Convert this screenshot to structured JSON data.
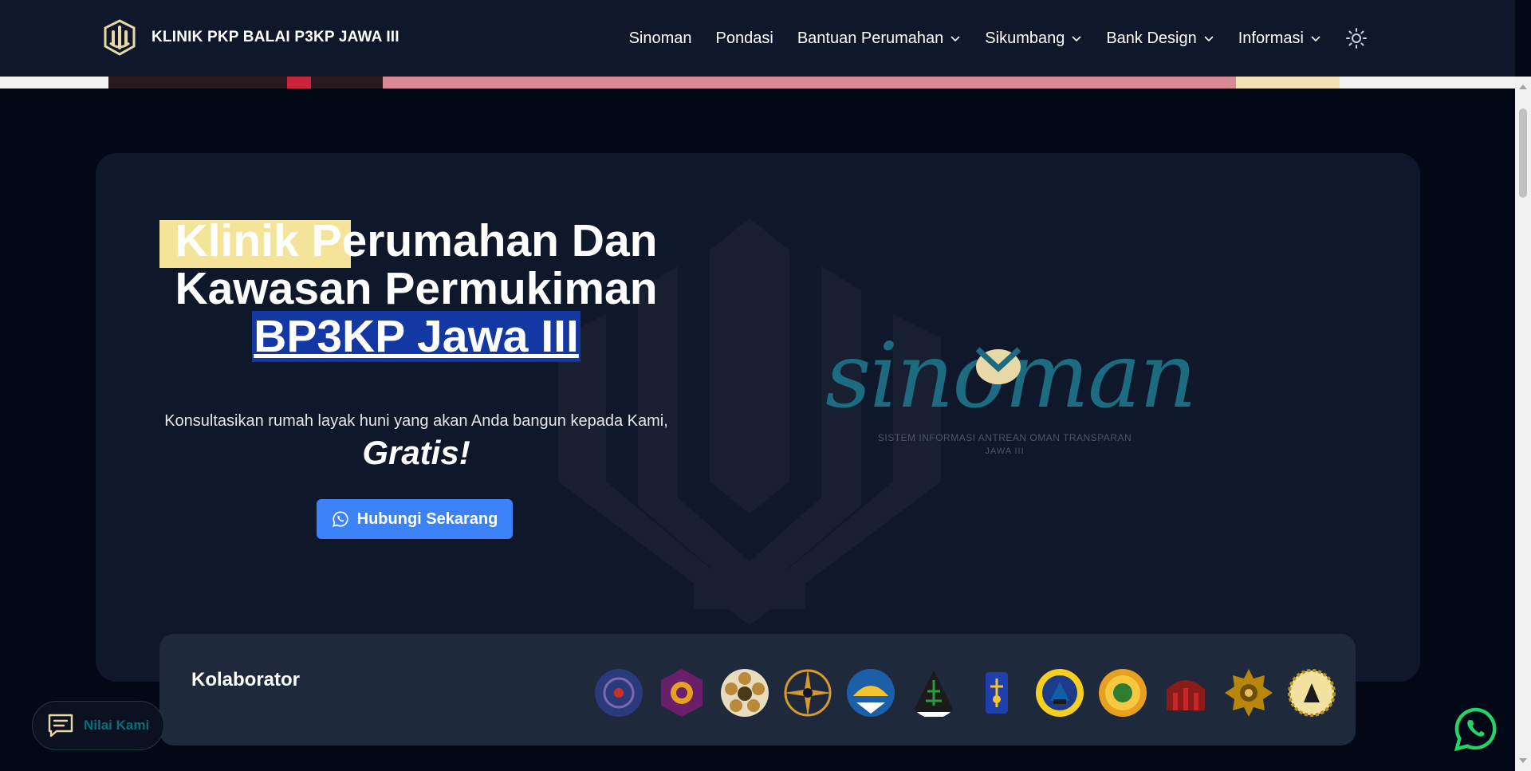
{
  "brand": {
    "name": "KLINIK PKP BALAI P3KP JAWA III",
    "logo_icon": "building-logo-icon"
  },
  "nav": {
    "items": [
      {
        "label": "Sinoman",
        "has_dropdown": false
      },
      {
        "label": "Pondasi",
        "has_dropdown": false
      },
      {
        "label": "Bantuan Perumahan",
        "has_dropdown": true
      },
      {
        "label": "Sikumbang",
        "has_dropdown": true
      },
      {
        "label": "Bank Design",
        "has_dropdown": true
      },
      {
        "label": "Informasi",
        "has_dropdown": true
      }
    ],
    "theme_toggle_icon": "sun-icon"
  },
  "hero": {
    "title_line1_highlight": "Klinik Pe",
    "title_line1_rest": "rumahan Dan",
    "title_line2": "Kawasan Permukiman",
    "title_line3": "BP3KP Jawa III",
    "description": "Konsultasikan rumah layak huni yang akan Anda bangun kepada Kami,",
    "free_text": "Gratis!",
    "cta_label": "Hubungi Sekarang",
    "cta_icon": "whatsapp-icon"
  },
  "sinoman": {
    "wordmark": "sinoman",
    "subtitle": "SISTEM INFORMASI ANTREAN OMAN TRANSPARAN",
    "subtitle2": "JAWA III"
  },
  "collaborators": {
    "title": "Kolaborator",
    "logos": [
      "university-seal-1",
      "university-seal-2",
      "ugm-seal",
      "university-seal-4",
      "university-seal-5",
      "university-seal-6",
      "university-seal-7",
      "university-seal-8",
      "university-seal-9",
      "university-seal-10",
      "university-seal-11",
      "university-seal-12"
    ]
  },
  "feedback": {
    "label": "Nilai Kami",
    "icon": "chat-icon"
  },
  "floating_whatsapp": {
    "icon": "whatsapp-icon"
  },
  "colors": {
    "navbar_bg": "#0f172a",
    "page_bg": "#030817",
    "card_bg": "#0f172a",
    "cta_bg": "#3b82f6",
    "highlight_yellow": "#f3e49a",
    "highlight_blue": "#1338a3",
    "sinoman_teal": "#1d6b80",
    "whatsapp_green": "#25d366"
  }
}
